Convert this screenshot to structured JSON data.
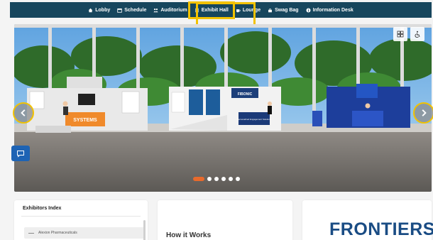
{
  "nav": {
    "items": [
      {
        "label": "Lobby",
        "icon": "home-icon"
      },
      {
        "label": "Schedule",
        "icon": "calendar-icon"
      },
      {
        "label": "Auditorium",
        "icon": "people-icon"
      },
      {
        "label": "Exhibit Hall",
        "icon": "building-icon",
        "active": true
      },
      {
        "label": "Lounge",
        "icon": "coffee-icon"
      },
      {
        "label": "Swag Bag",
        "icon": "bag-icon"
      },
      {
        "label": "Information Desk",
        "icon": "info-icon"
      }
    ]
  },
  "hero": {
    "booths": [
      {
        "sign": "SYSTEMS"
      },
      {
        "sign": "FIBONIC"
      },
      {
        "sign": "Personalized Engagement Solutions"
      }
    ],
    "slide_count": 6,
    "active_slide": 1
  },
  "exhibitors": {
    "title": "Exhibitors Index",
    "first_item": "Alexion Pharmaceuticals"
  },
  "how_it_works": {
    "title": "How it Works"
  },
  "sponsor": {
    "logo_text": "FRONTIERS"
  },
  "colors": {
    "nav_bg": "#17465d",
    "highlight": "#f2c200",
    "active_dot": "#e86a2c",
    "chat_btn": "#1e63b4",
    "logo": "#1a4c84"
  }
}
